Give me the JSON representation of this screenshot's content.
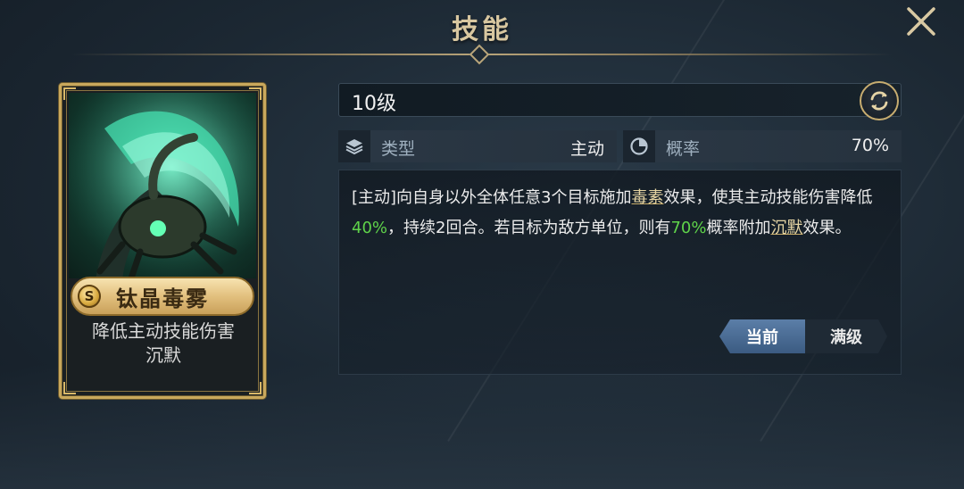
{
  "header": {
    "title": "技能"
  },
  "card": {
    "rank_badge": "S",
    "name": "钛晶毒雾",
    "desc_line1": "降低主动技能伤害",
    "desc_line2": "沉默"
  },
  "level": {
    "value": "10级"
  },
  "stats": {
    "type_label": "类型",
    "type_value": "主动",
    "rate_label": "概率",
    "rate_value": "70%"
  },
  "description": {
    "p1": "[主动]向自身以外全体任意3个目标施加",
    "kw1": "毒素",
    "p2": "效果，使其主动技能伤害降低",
    "n1": "40%",
    "p3": "，持续2回合。若目标为敌方单位，则有",
    "n2": "70%",
    "p4": "概率附加",
    "kw2": "沉默",
    "p5": "效果。"
  },
  "tabs": {
    "current": "当前",
    "max": "满级"
  },
  "colors": {
    "gold": "#c9a85c",
    "highlight_green": "#5fd34a",
    "tab_active": "#4a6d95"
  }
}
